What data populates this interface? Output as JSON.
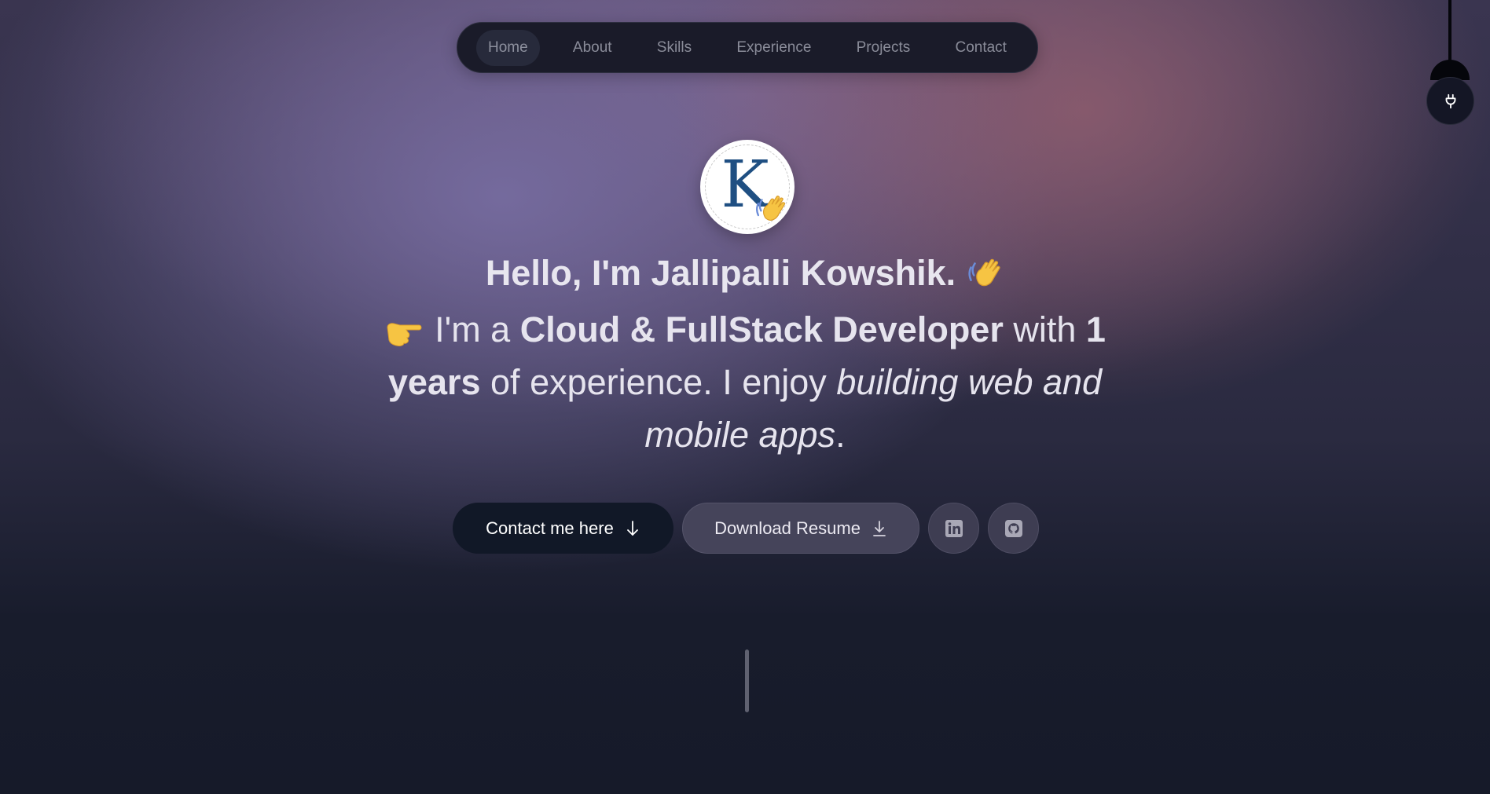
{
  "nav": {
    "items": [
      {
        "label": "Home"
      },
      {
        "label": "About"
      },
      {
        "label": "Skills"
      },
      {
        "label": "Experience"
      },
      {
        "label": "Projects"
      },
      {
        "label": "Contact"
      }
    ],
    "active": "Home"
  },
  "avatar": {
    "letter": "K"
  },
  "hero": {
    "greeting": "Hello, I'm Jallipalli Kowshik.",
    "intro": {
      "p1": "I'm a ",
      "role": "Cloud & FullStack Developer",
      "p2": " with ",
      "years": "1 years",
      "p3": " of experience. I enjoy ",
      "focus": "building web and mobile apps",
      "p4": "."
    }
  },
  "actions": {
    "contact_label": "Contact me here",
    "resume_label": "Download Resume"
  },
  "icons": [
    "lightbulb-icon",
    "waving-hand-icon",
    "pointing-hand-icon",
    "arrow-down-icon",
    "download-icon",
    "linkedin-icon",
    "github-icon"
  ],
  "colors": {
    "nav_bg": "#1a1b29",
    "contact_button_bg": "#111827",
    "resume_button_bg": "#45445a",
    "avatar_letter": "#1f4f82",
    "emoji_yellow": "#f6c443"
  }
}
